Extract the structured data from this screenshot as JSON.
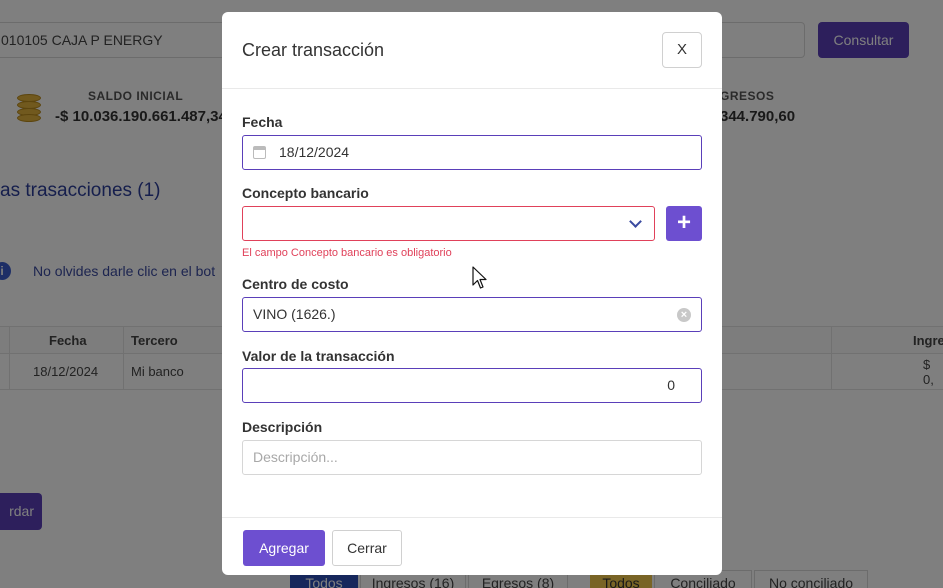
{
  "background": {
    "account_select": "010105 CAJA P ENERGY",
    "consultar_label": "Consultar",
    "saldo_inicial_label": "SALDO INICIAL",
    "saldo_inicial_value": "-$ 10.036.190.661.487,34",
    "ingresos_label": "GRESOS",
    "ingresos_value": "344.790,60",
    "section_title": "as trasacciones (1)",
    "info_text": "No olvides darle clic en el bot",
    "table": {
      "headers": [
        "Fecha",
        "Tercero",
        "Ingre"
      ],
      "row": [
        "18/12/2024",
        "Mi banco",
        "$ 0,"
      ]
    },
    "guardar_label": "rdar",
    "filters": [
      "Todos",
      "Ingresos (16)",
      "Egresos (8)",
      "Todos",
      "Conciliado",
      "No conciliado"
    ]
  },
  "modal": {
    "title": "Crear transacción",
    "close_label": "X",
    "fecha": {
      "label": "Fecha",
      "value": "18/12/2024"
    },
    "concepto": {
      "label": "Concepto bancario",
      "value": "",
      "error": "El campo Concepto bancario es obligatorio",
      "add_label": "+"
    },
    "centro_costo": {
      "label": "Centro de costo",
      "value": "VINO (1626.)"
    },
    "valor": {
      "label": "Valor de la transacción",
      "value": "0"
    },
    "descripcion": {
      "label": "Descripción",
      "placeholder": "Descripción..."
    },
    "footer": {
      "agregar_label": "Agregar",
      "cerrar_label": "Cerrar"
    }
  },
  "colors": {
    "primary": "#6d4fd0",
    "error": "#e0415a",
    "overlay": "rgba(0,0,0,0.5)"
  },
  "icons": [
    "calendar-icon",
    "chevron-down-icon",
    "plus-icon",
    "clear-icon",
    "info-icon",
    "coins-icon",
    "cursor-icon"
  ]
}
